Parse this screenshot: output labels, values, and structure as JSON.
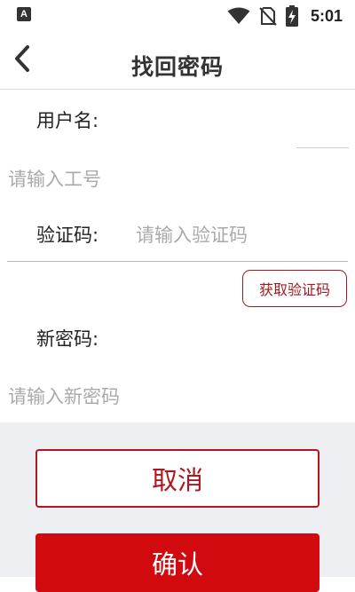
{
  "status_bar": {
    "app_badge": "A",
    "time": "5:01"
  },
  "header": {
    "title": "找回密码"
  },
  "form": {
    "username_label": "用户名:",
    "username_placeholder": "请输入工号",
    "code_label": "验证码:",
    "code_placeholder": "请输入验证码",
    "get_code_label": "获取验证码",
    "new_password_label": "新密码:",
    "new_password_placeholder": "请输入新密码"
  },
  "actions": {
    "cancel_label": "取消",
    "confirm_label": "确认"
  },
  "colors": {
    "accent": "#d10a0f",
    "accent_dark": "#b3141d",
    "panel_bg": "#eeeff3"
  },
  "icons": {
    "back": "chevron-left-icon",
    "wifi": "wifi-icon",
    "signal": "no-sim-icon",
    "battery": "battery-charging-icon"
  }
}
